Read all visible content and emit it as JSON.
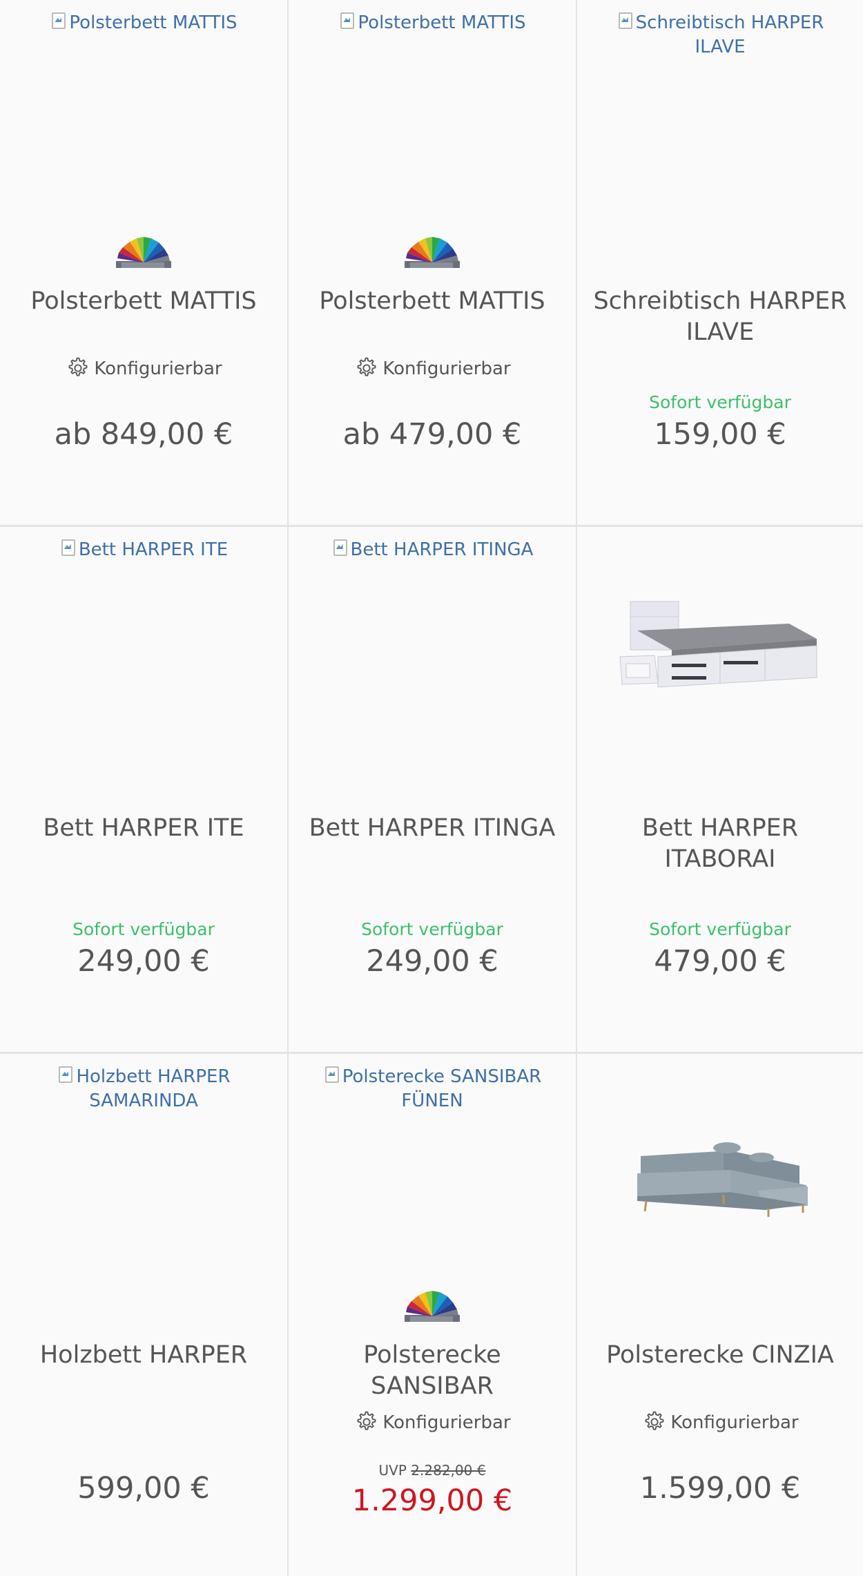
{
  "products": [
    {
      "image_alt": "Polsterbett MATTIS",
      "title": "Polsterbett MATTIS",
      "config_label": "Konfigurierbar",
      "price": "ab 849,00 €"
    },
    {
      "image_alt": "Polsterbett MATTIS",
      "title": "Polsterbett MATTIS",
      "config_label": "Konfigurierbar",
      "price": "ab 479,00 €"
    },
    {
      "image_alt": "Schreibtisch HARPER ILAVE",
      "title": "Schreibtisch HARPER ILAVE",
      "availability": "Sofort verfügbar",
      "price": "159,00 €"
    },
    {
      "image_alt": "Bett HARPER ITE",
      "title": "Bett HARPER ITE",
      "availability": "Sofort verfügbar",
      "price": "249,00 €"
    },
    {
      "image_alt": "Bett HARPER ITINGA",
      "title": "Bett HARPER ITINGA",
      "availability": "Sofort verfügbar",
      "price": "249,00 €"
    },
    {
      "title": "Bett HARPER ITABORAI",
      "availability": "Sofort verfügbar",
      "price": "479,00 €"
    },
    {
      "image_alt": "Holzbett HARPER SAMARINDA",
      "title": "Holzbett HARPER",
      "price": "599,00 €"
    },
    {
      "image_alt": "Polsterecke SANSIBAR FÜNEN",
      "title": "Polsterecke SANSIBAR",
      "config_label": "Konfigurierbar",
      "uvp_label": "UVP",
      "uvp_price": "2.282,00 €",
      "price": "1.299,00 €"
    },
    {
      "title": "Polsterecke CINZIA",
      "config_label": "Konfigurierbar",
      "price": "1.599,00 €"
    }
  ],
  "colors": {
    "link_blue": "#3e6fa8",
    "available_green": "#3cbf6c",
    "sale_red": "#d0141e",
    "text_gray": "#555555"
  }
}
